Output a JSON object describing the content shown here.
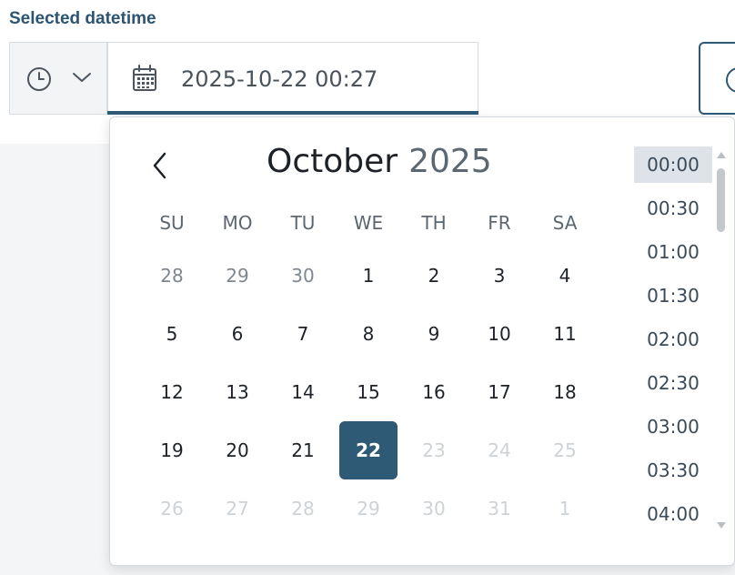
{
  "field": {
    "label": "Selected datetime",
    "value": "2025-10-22 00:27"
  },
  "icons": {
    "mode": "clock-icon",
    "mode_toggle": "chevron-down-icon",
    "input": "calendar-icon",
    "prev": "chevron-left-icon"
  },
  "calendar": {
    "month": "October",
    "year": "2025",
    "weekdays": [
      "SU",
      "MO",
      "TU",
      "WE",
      "TH",
      "FR",
      "SA"
    ],
    "weeks": [
      [
        {
          "d": "28",
          "t": "prev"
        },
        {
          "d": "29",
          "t": "prev"
        },
        {
          "d": "30",
          "t": "prev"
        },
        {
          "d": "1",
          "t": "cur"
        },
        {
          "d": "2",
          "t": "cur"
        },
        {
          "d": "3",
          "t": "cur"
        },
        {
          "d": "4",
          "t": "cur"
        }
      ],
      [
        {
          "d": "5",
          "t": "cur"
        },
        {
          "d": "6",
          "t": "cur"
        },
        {
          "d": "7",
          "t": "cur"
        },
        {
          "d": "8",
          "t": "cur"
        },
        {
          "d": "9",
          "t": "cur"
        },
        {
          "d": "10",
          "t": "cur"
        },
        {
          "d": "11",
          "t": "cur"
        }
      ],
      [
        {
          "d": "12",
          "t": "cur"
        },
        {
          "d": "13",
          "t": "cur"
        },
        {
          "d": "14",
          "t": "cur"
        },
        {
          "d": "15",
          "t": "cur"
        },
        {
          "d": "16",
          "t": "cur"
        },
        {
          "d": "17",
          "t": "cur"
        },
        {
          "d": "18",
          "t": "cur"
        }
      ],
      [
        {
          "d": "19",
          "t": "cur"
        },
        {
          "d": "20",
          "t": "cur"
        },
        {
          "d": "21",
          "t": "cur"
        },
        {
          "d": "22",
          "t": "sel"
        },
        {
          "d": "23",
          "t": "next"
        },
        {
          "d": "24",
          "t": "next"
        },
        {
          "d": "25",
          "t": "next"
        }
      ],
      [
        {
          "d": "26",
          "t": "next"
        },
        {
          "d": "27",
          "t": "next"
        },
        {
          "d": "28",
          "t": "next"
        },
        {
          "d": "29",
          "t": "next"
        },
        {
          "d": "30",
          "t": "next"
        },
        {
          "d": "31",
          "t": "next"
        },
        {
          "d": "1",
          "t": "next"
        }
      ]
    ]
  },
  "times": [
    "00:00",
    "00:30",
    "01:00",
    "01:30",
    "02:00",
    "02:30",
    "03:00",
    "03:30",
    "04:00"
  ],
  "selected_time": "00:00",
  "colors": {
    "accent": "#2f5a76",
    "label": "#2d5470",
    "selected_time_bg": "#dde3e8"
  }
}
